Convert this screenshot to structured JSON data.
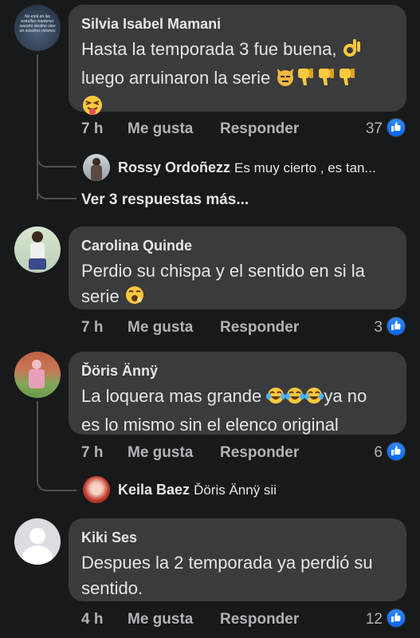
{
  "comments": [
    {
      "author": "Silvia Isabel Mamani",
      "line1": "Hasta la temporada 3 fue buena,",
      "line2": "luego arruinaron la serie",
      "time": "7 h",
      "like_label": "Me gusta",
      "reply_label": "Responder",
      "reaction_count": "37",
      "avatar_text": "No está en las estrellas mantener nuestro destino sino en nosotros mismos"
    },
    {
      "author": "Carolina Quinde",
      "line1": "Perdio su chispa y el sentido en si la",
      "line2": "serie",
      "time": "7 h",
      "like_label": "Me gusta",
      "reply_label": "Responder",
      "reaction_count": "3"
    },
    {
      "author": "Ďöris Ännÿ",
      "line1": "La loquera mas grande",
      "line1b": "ya no",
      "line2": "es lo mismo sin el elenco original",
      "time": "7 h",
      "like_label": "Me gusta",
      "reply_label": "Responder",
      "reaction_count": "6"
    },
    {
      "author": "Kiki Ses",
      "line1": "Despues la 2 temporada ya perdió su",
      "line2": "sentido.",
      "time": "4 h",
      "like_label": "Me gusta",
      "reply_label": "Responder",
      "reaction_count": "12"
    }
  ],
  "replies": [
    {
      "author": "Rossy Ordoñezz",
      "text": "Es muy cierto , es tan..."
    },
    {
      "author": "Keila Baez",
      "text": "Ďöris Ännÿ  sii"
    }
  ],
  "more_replies_label": "Ver 3 respuestas más...",
  "colors": {
    "background": "#18191a",
    "bubble": "#3a3b3c",
    "text": "#e4e6eb",
    "muted": "#b0b3b8",
    "like": "#0866ff"
  }
}
